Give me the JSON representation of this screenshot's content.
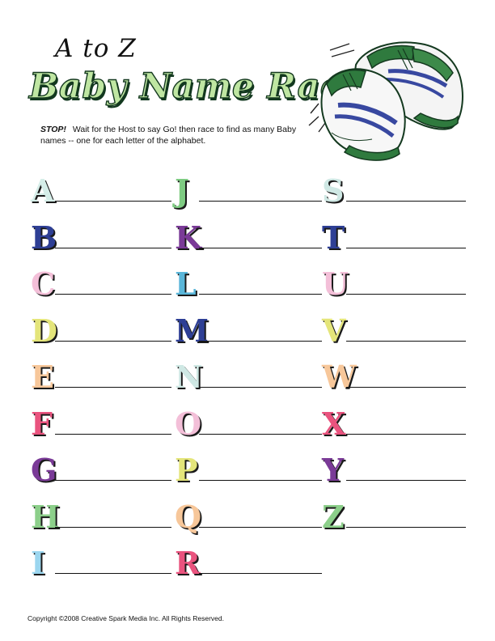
{
  "header": {
    "subtitle": "A to Z",
    "title": "Baby Name Race",
    "instructions_lead": "STOP!",
    "instructions_body": "Wait for the Host to say Go! then race to find as many Baby names -- one for each letter of the alphabet."
  },
  "illustration": {
    "name": "baby-sneakers"
  },
  "letters": [
    {
      "char": "A",
      "color": "#d5ede8"
    },
    {
      "char": "B",
      "color": "#2e3f95"
    },
    {
      "char": "C",
      "color": "#f3bfd8"
    },
    {
      "char": "D",
      "color": "#e4e57a"
    },
    {
      "char": "E",
      "color": "#f7c79a"
    },
    {
      "char": "F",
      "color": "#e9537e"
    },
    {
      "char": "G",
      "color": "#7a3a97"
    },
    {
      "char": "H",
      "color": "#8ccf8a"
    },
    {
      "char": "I",
      "color": "#9bd6ef"
    },
    {
      "char": "J",
      "color": "#7ecb82"
    },
    {
      "char": "K",
      "color": "#7a3a97"
    },
    {
      "char": "L",
      "color": "#5ab6d9"
    },
    {
      "char": "M",
      "color": "#2e3f95"
    },
    {
      "char": "N",
      "color": "#cfe8e4"
    },
    {
      "char": "O",
      "color": "#f3bfd8"
    },
    {
      "char": "P",
      "color": "#e4e57a"
    },
    {
      "char": "Q",
      "color": "#f7c79a"
    },
    {
      "char": "R",
      "color": "#e9537e"
    },
    {
      "char": "S",
      "color": "#cfe8e4"
    },
    {
      "char": "T",
      "color": "#2e3f95"
    },
    {
      "char": "U",
      "color": "#f3bfd8"
    },
    {
      "char": "V",
      "color": "#e4e57a"
    },
    {
      "char": "W",
      "color": "#f7c79a"
    },
    {
      "char": "X",
      "color": "#e9537e"
    },
    {
      "char": "Y",
      "color": "#7a3a97"
    },
    {
      "char": "Z",
      "color": "#8ccf8a"
    }
  ],
  "footer": {
    "copyright": "Copyright ©2008  Creative Spark Media Inc.  All Rights Reserved."
  }
}
